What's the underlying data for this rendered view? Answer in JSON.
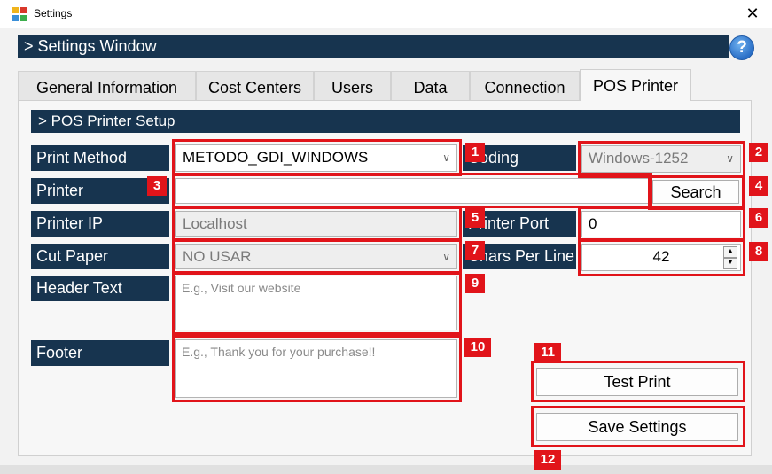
{
  "window": {
    "title": "Settings",
    "close": "✕",
    "help": "?"
  },
  "header": {
    "title": "> Settings Window"
  },
  "tabs": [
    {
      "label": "General Information"
    },
    {
      "label": "Cost Centers"
    },
    {
      "label": "Users"
    },
    {
      "label": "Data"
    },
    {
      "label": "Connection"
    },
    {
      "label": "POS Printer"
    }
  ],
  "section": {
    "title": "> POS Printer Setup"
  },
  "form": {
    "print_method": {
      "label": "Print Method",
      "value": "METODO_GDI_WINDOWS"
    },
    "coding": {
      "label": "Coding",
      "value": "Windows-1252"
    },
    "printer": {
      "label": "Printer",
      "value": ""
    },
    "search_button": "Search",
    "printer_ip": {
      "label": "Printer IP",
      "value": "Localhost"
    },
    "printer_port": {
      "label": "Printer Port",
      "value": "0"
    },
    "cut_paper": {
      "label": "Cut Paper",
      "value": "NO USAR"
    },
    "chars_per_line": {
      "label": "Chars Per Line",
      "value": "42"
    },
    "header_text": {
      "label": "Header Text",
      "placeholder": "E.g., Visit our website"
    },
    "footer": {
      "label": "Footer",
      "placeholder": "E.g., Thank you for your purchase!!"
    },
    "test_print_button": "Test Print",
    "save_settings_button": "Save Settings"
  },
  "annotations": [
    "1",
    "2",
    "3",
    "4",
    "5",
    "6",
    "7",
    "8",
    "9",
    "10",
    "11",
    "12"
  ],
  "colors": {
    "accent": "#17344f",
    "annotation": "#e1141a"
  }
}
